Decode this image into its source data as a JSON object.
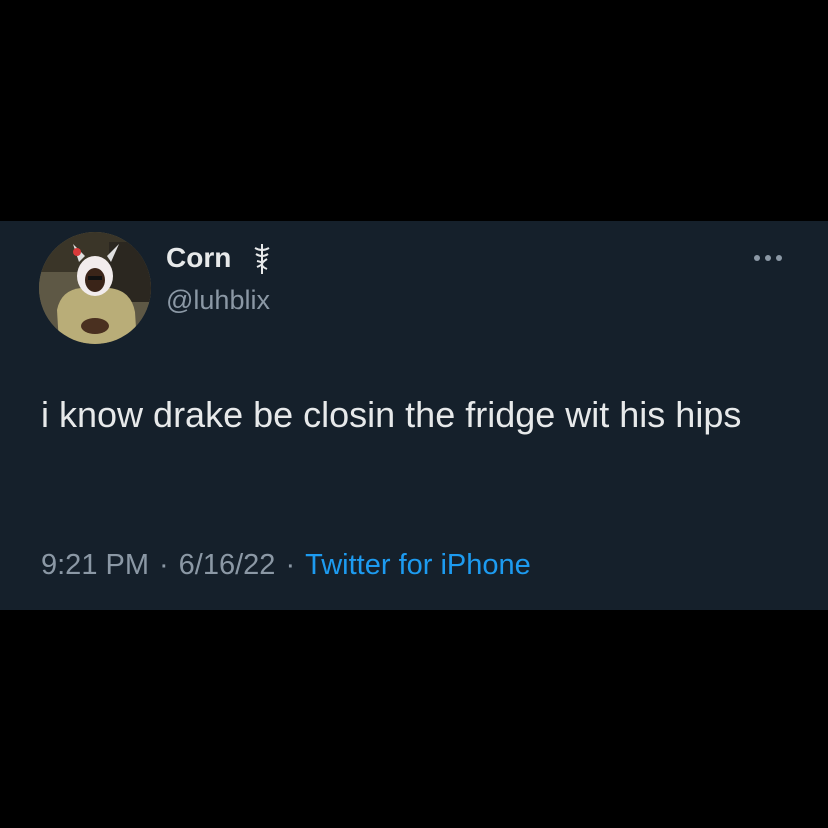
{
  "tweet": {
    "author": {
      "display_name": "Corn",
      "name_emoji": "staff-of-hermes-emoji",
      "handle": "@luhblix"
    },
    "more_icon": "more-horizontal-icon",
    "text": "i know drake be closin the fridge wit his hips",
    "time": "9:21 PM",
    "separator": "·",
    "date": "6/16/22",
    "source": "Twitter for iPhone"
  },
  "colors": {
    "background": "#000000",
    "card": "#15202b",
    "primary_text": "#e7e9ea",
    "secondary_text": "#8b98a5",
    "link": "#1d9bf0"
  }
}
